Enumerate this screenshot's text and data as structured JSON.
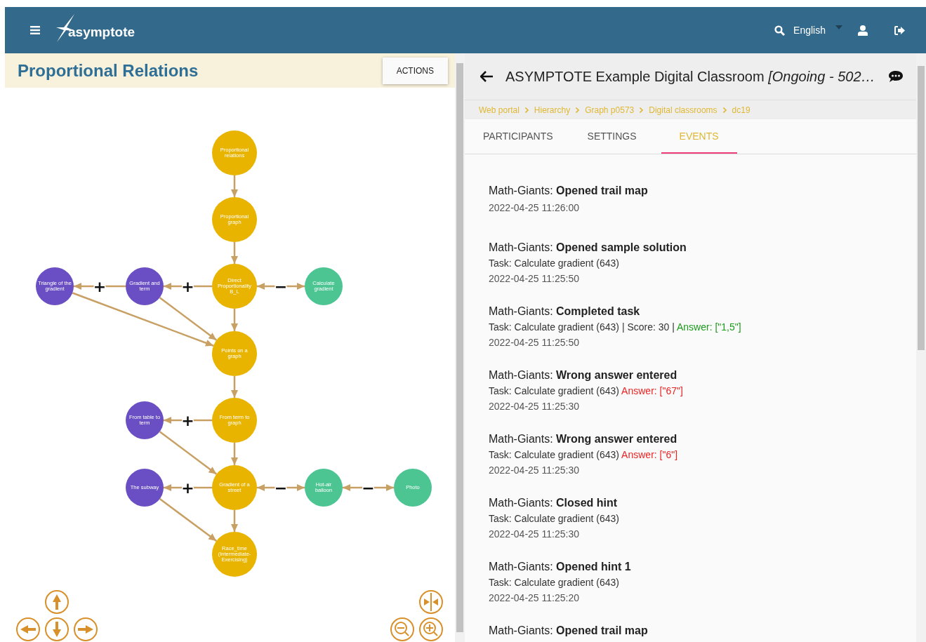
{
  "header": {
    "brand": "asymptote",
    "language": "English"
  },
  "map": {
    "title": "Proportional Relations",
    "actions_button": "ACTIONS",
    "nodes": [
      {
        "label": "Proportional relations",
        "color": "#e8b400"
      },
      {
        "label": "Proportional graph",
        "color": "#e8b400"
      },
      {
        "label": "Direct Proportionality B_L",
        "color": "#e8b400"
      },
      {
        "label": "Points on a graph",
        "color": "#e8b400"
      },
      {
        "label": "From term to graph",
        "color": "#e8b400"
      },
      {
        "label": "Gradient of a street",
        "color": "#e8b400"
      },
      {
        "label": "Race_time (Intermediate-Exercising)",
        "color": "#e8b400"
      },
      {
        "label": "Triangle of the gradient",
        "color": "#6a4fc4"
      },
      {
        "label": "Gradient and term",
        "color": "#6a4fc4"
      },
      {
        "label": "Calculate gradient",
        "color": "#4cc593"
      },
      {
        "label": "From table to term",
        "color": "#6a4fc4"
      },
      {
        "label": "The subway",
        "color": "#6a4fc4"
      },
      {
        "label": "Hot-air balloon",
        "color": "#4cc593"
      },
      {
        "label": "Photo",
        "color": "#4cc593"
      }
    ],
    "edges": [
      {
        "kind": "arrow"
      },
      {
        "kind": "arrow"
      },
      {
        "kind": "arrow"
      },
      {
        "kind": "arrow"
      },
      {
        "kind": "arrow"
      },
      {
        "kind": "arrow"
      },
      {
        "kind": "plus",
        "sign": "+"
      },
      {
        "kind": "plus",
        "sign": "+"
      },
      {
        "kind": "minus",
        "sign": "−"
      },
      {
        "kind": "arrow"
      },
      {
        "kind": "arrow"
      },
      {
        "kind": "plus",
        "sign": "+"
      },
      {
        "kind": "arrow"
      },
      {
        "kind": "plus",
        "sign": "+"
      },
      {
        "kind": "arrow"
      },
      {
        "kind": "minus",
        "sign": "−"
      },
      {
        "kind": "minus",
        "sign": "−"
      }
    ]
  },
  "classroom": {
    "title": "ASYMPTOTE Example Digital Classroom *[Ongoing - 502…*",
    "breadcrumbs": [
      "Web portal",
      "Hierarchy",
      "Graph p0573",
      "Digital classrooms",
      "dc19"
    ],
    "tabs": [
      {
        "label": "PARTICIPANTS",
        "selected": false
      },
      {
        "label": "SETTINGS",
        "selected": false
      },
      {
        "label": "EVENTS",
        "selected": true
      }
    ],
    "events": [
      {
        "title": "Math-Giants: **Opened trail map**",
        "time": "2022-04-25 11:26:00"
      },
      {
        "title": "Math-Giants: **Opened sample solution**",
        "detail": "Task: Calculate gradient (643)",
        "time": "2022-04-25 11:25:50"
      },
      {
        "title": "Math-Giants: **Completed task**",
        "detail": "Task: Calculate gradient (643) | Score: 30 | ",
        "answer": {
          "text": "Answer: [\"1,5\"]",
          "kind": "correct"
        },
        "time": "2022-04-25 11:25:50"
      },
      {
        "title": "Math-Giants: **Wrong answer entered**",
        "detail": "Task: Calculate gradient (643) ",
        "answer": {
          "text": "Answer: [\"67\"]",
          "kind": "wrong"
        },
        "time": "2022-04-25 11:25:30"
      },
      {
        "title": "Math-Giants: **Wrong answer entered**",
        "detail": "Task: Calculate gradient (643) ",
        "answer": {
          "text": "Answer: [\"6\"]",
          "kind": "wrong"
        },
        "time": "2022-04-25 11:25:30"
      },
      {
        "title": "Math-Giants: **Closed hint**",
        "detail": "Task: Calculate gradient (643)",
        "time": "2022-04-25 11:25:30"
      },
      {
        "title": "Math-Giants: **Opened hint 1**",
        "detail": "Task: Calculate gradient (643)",
        "time": "2022-04-25 11:25:20"
      },
      {
        "title": "Math-Giants: **Opened trail map**"
      }
    ]
  }
}
